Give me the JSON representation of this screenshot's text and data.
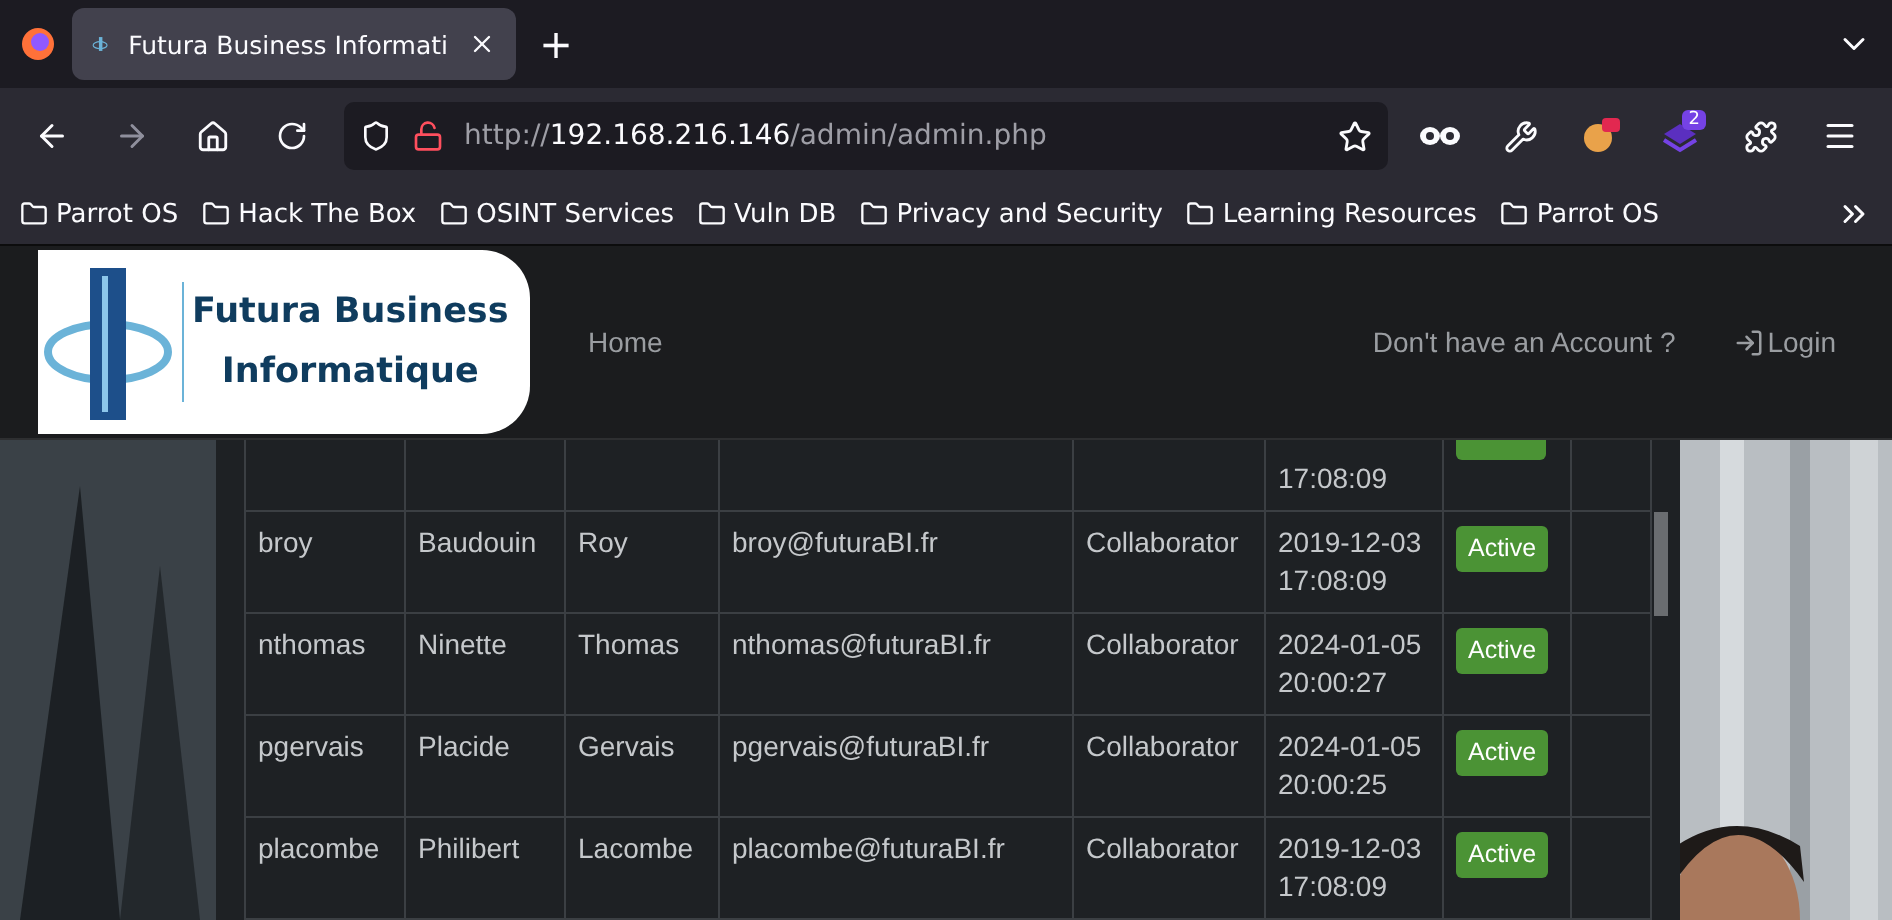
{
  "browser": {
    "tabs": [
      {
        "title": "Futura Business Informati",
        "selected": true
      }
    ],
    "new_tab": "+",
    "address": {
      "scheme": "http://",
      "host": "192.168.216.146",
      "path": "/admin/admin.php"
    },
    "extension_badge": "2",
    "bookmarks": [
      "Parrot OS",
      "Hack The Box",
      "OSINT Services",
      "Vuln DB",
      "Privacy and Security",
      "Learning Resources",
      "Parrot OS"
    ]
  },
  "navbar": {
    "logo": {
      "line1": "Futura Business",
      "line2": "Informatique"
    },
    "links": [
      "Home"
    ],
    "account_prompt": "Don't have an Account ?",
    "login": "Login"
  },
  "table": {
    "rows": [
      {
        "kind": "cut",
        "created": [
          "17:08:09"
        ]
      },
      {
        "kind": "full",
        "username": "broy",
        "first_name": "Baudouin",
        "last_name": "Roy",
        "email": "broy@futuraBI.fr",
        "role": "Collaborator",
        "created": [
          "2019-12-03",
          "17:08:09"
        ],
        "status": "Active"
      },
      {
        "kind": "full",
        "username": "nthomas",
        "first_name": "Ninette",
        "last_name": "Thomas",
        "email": "nthomas@futuraBI.fr",
        "role": "Collaborator",
        "created": [
          "2024-01-05",
          "20:00:27"
        ],
        "status": "Active"
      },
      {
        "kind": "full",
        "username": "pgervais",
        "first_name": "Placide",
        "last_name": "Gervais",
        "email": "pgervais@futuraBI.fr",
        "role": "Collaborator",
        "created": [
          "2024-01-05",
          "20:00:25"
        ],
        "status": "Active"
      },
      {
        "kind": "full",
        "username": "placombe",
        "first_name": "Philibert",
        "last_name": "Lacombe",
        "email": "placombe@futuraBI.fr",
        "role": "Collaborator",
        "created": [
          "2019-12-03",
          "17:08:09"
        ],
        "status": "Active"
      }
    ]
  }
}
